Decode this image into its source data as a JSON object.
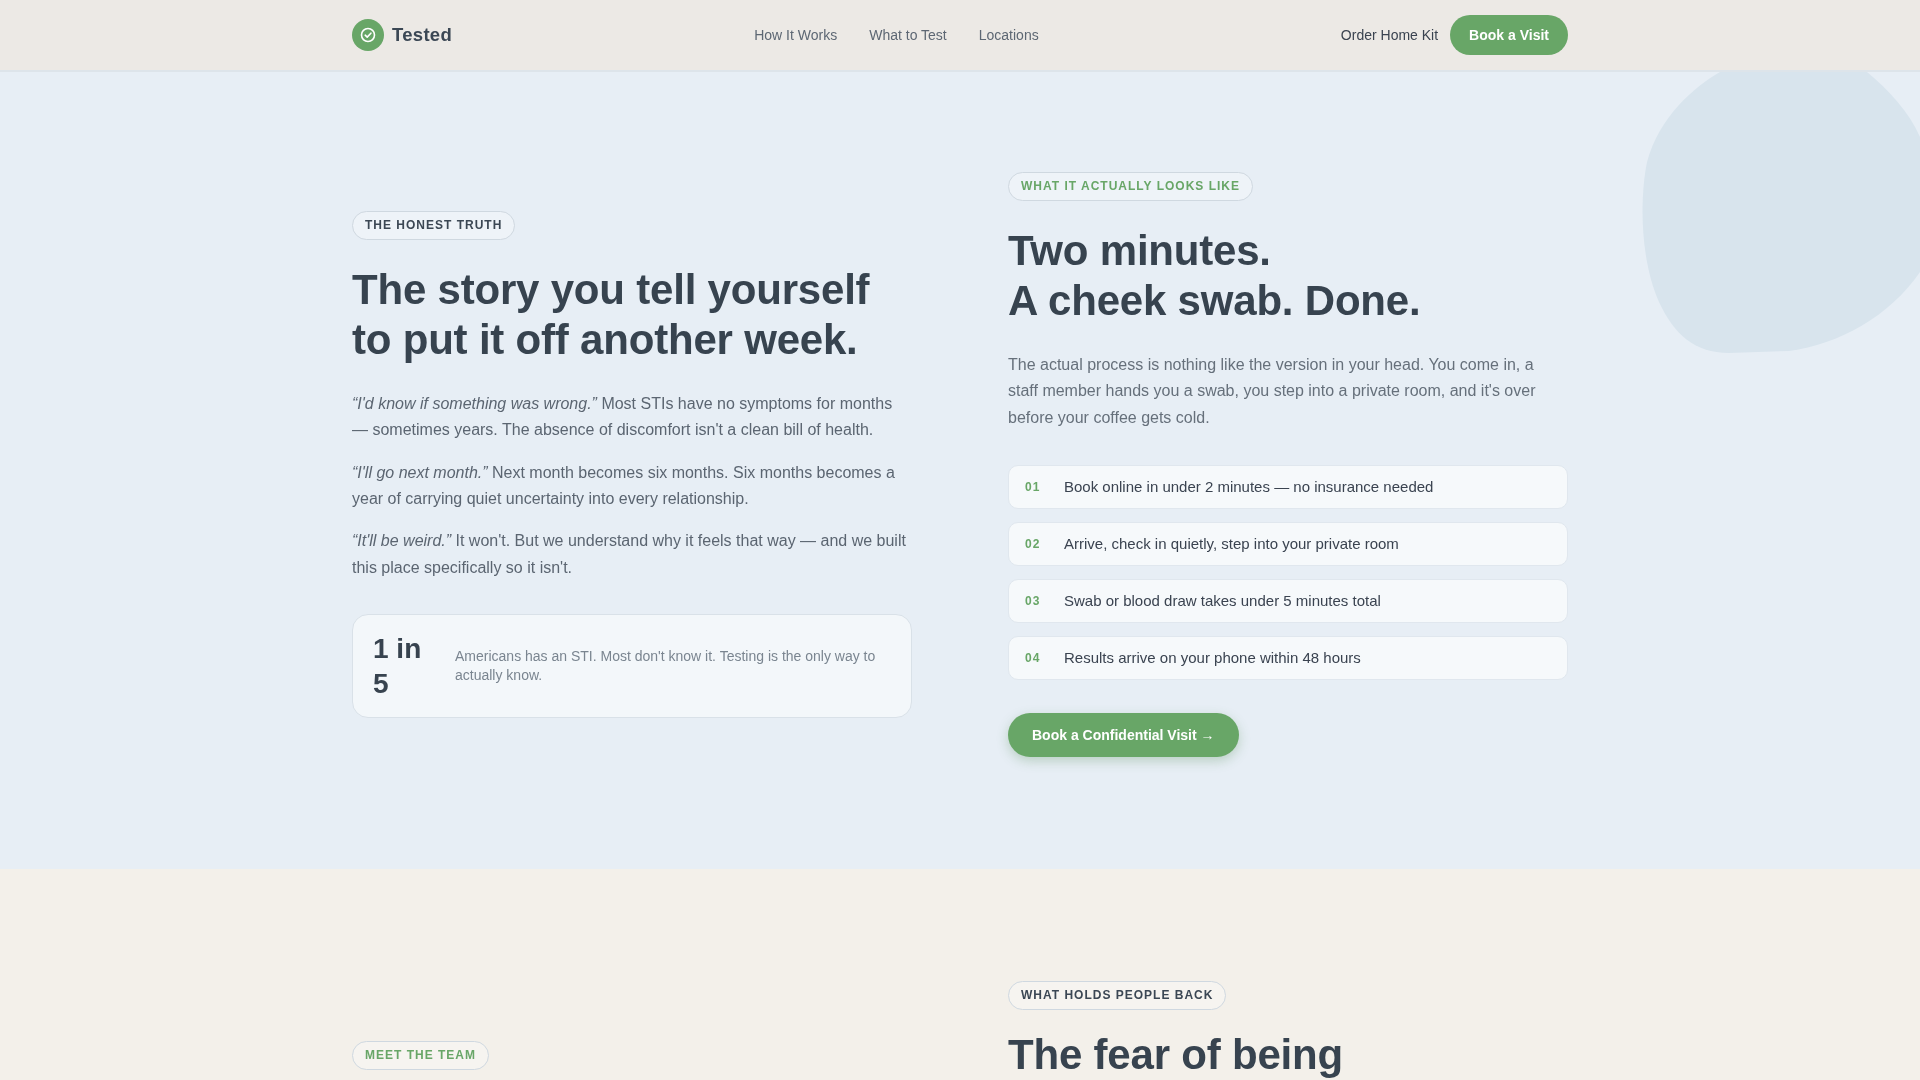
{
  "nav": {
    "brand": "Tested",
    "links": [
      {
        "label": "How It Works"
      },
      {
        "label": "What to Test"
      },
      {
        "label": "Locations"
      }
    ],
    "secondary_link": "Order Home Kit",
    "cta": "Book a Visit"
  },
  "hero": {
    "left": {
      "eyebrow": {
        "text": "THE HONEST TRUTH",
        "accent": false
      },
      "heading": "The story you tell yourself to put it off another week.",
      "paragraphs": [
        "*“I'd know if something was wrong.”* Most STIs have no symptoms for months — sometimes years. The absence of discomfort isn't a clean bill of health.",
        "*“I'll go next month.”* Next month becomes six months. Six months becomes a year of carrying quiet uncertainty into every relationship.",
        "*“It'll be weird.”* It won't. But we understand why it feels that way — and we built this place specifically so it isn't."
      ],
      "stat": {
        "value": "1 in 5",
        "text": "Americans has an STI. Most don't know it. Testing is the only way to actually know."
      }
    },
    "right": {
      "eyebrow": {
        "text": "WHAT IT ACTUALLY LOOKS LIKE",
        "accent": true
      },
      "heading_lines": [
        "Two minutes.",
        "A cheek swab. Done."
      ],
      "paragraph": "The actual process is nothing like the version in your head. You come in, a staff member hands you a swab, you step into a private room, and it's over before your coffee gets cold.",
      "steps": [
        {
          "number": "01",
          "text": "Book online in under 2 minutes — no insurance needed"
        },
        {
          "number": "02",
          "text": "Arrive, check in quietly, step into your private room"
        },
        {
          "number": "03",
          "text": "Swab or blood draw takes under 5 minutes total"
        },
        {
          "number": "04",
          "text": "Results arrive on your phone within 48 hours"
        }
      ],
      "cta": "Book a Confidential Visit →"
    }
  },
  "next_section": {
    "left": {
      "eyebrow": {
        "text": "MEET THE TEAM",
        "accent": true
      }
    },
    "right": {
      "eyebrow": {
        "text": "WHAT HOLDS PEOPLE BACK",
        "accent": false
      },
      "heading": "The fear of being"
    }
  }
}
